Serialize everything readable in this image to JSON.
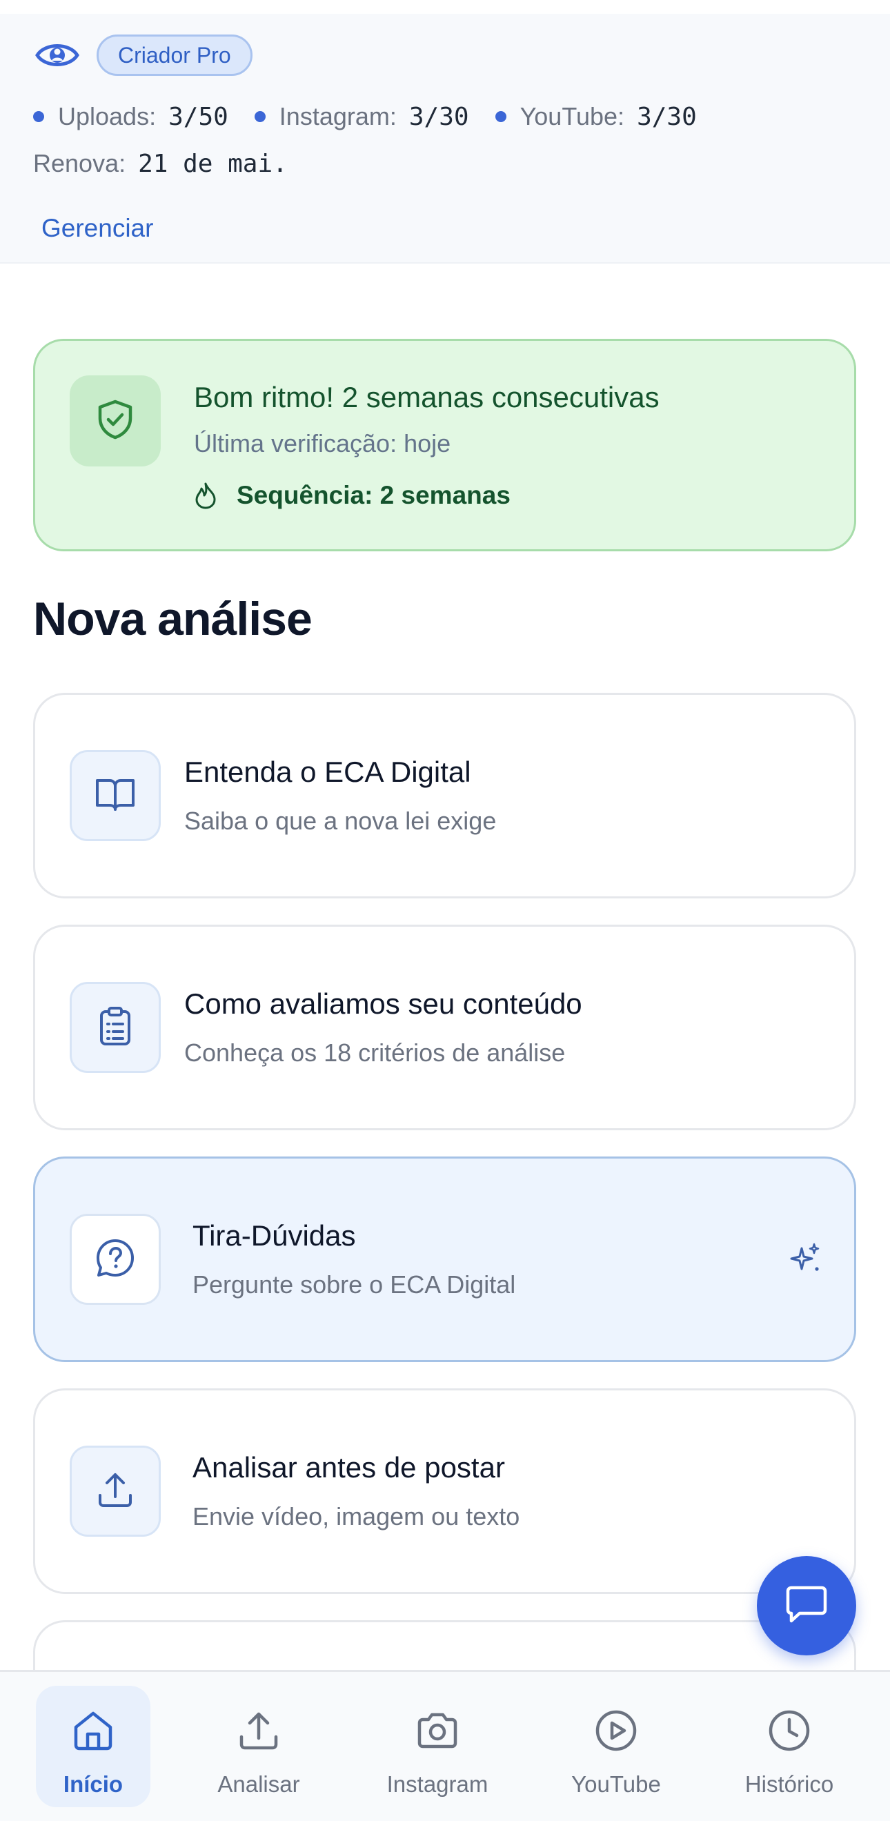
{
  "plan": {
    "badge": "Criador Pro",
    "usage": [
      {
        "label": "Uploads:",
        "value": "3/50"
      },
      {
        "label": "Instagram:",
        "value": "3/30"
      },
      {
        "label": "YouTube:",
        "value": "3/30"
      }
    ],
    "renew_label": "Renova:",
    "renew_value": "21 de mai.",
    "manage_label": "Gerenciar"
  },
  "streak": {
    "title": "Bom ritmo! 2 semanas consecutivas",
    "subtitle": "Última verificação: hoje",
    "count": "Sequência: 2 semanas"
  },
  "section_title": "Nova análise",
  "cards": [
    {
      "title": "Entenda o ECA Digital",
      "subtitle": "Saiba o que a nova lei exige",
      "icon": "book-icon"
    },
    {
      "title": "Como avaliamos seu conteúdo",
      "subtitle": "Conheça os 18 critérios de análise",
      "icon": "clipboard-list-icon"
    },
    {
      "title": "Tira-Dúvidas",
      "subtitle": "Pergunte sobre o ECA Digital",
      "icon": "help-bubble-icon"
    },
    {
      "title": "Analisar antes de postar",
      "subtitle": "Envie vídeo, imagem ou texto",
      "icon": "upload-icon"
    }
  ],
  "nav": [
    {
      "label": "Início",
      "icon": "home-icon"
    },
    {
      "label": "Analisar",
      "icon": "upload-icon"
    },
    {
      "label": "Instagram",
      "icon": "camera-icon"
    },
    {
      "label": "YouTube",
      "icon": "play-circle-icon"
    },
    {
      "label": "Histórico",
      "icon": "clock-icon"
    }
  ],
  "colors": {
    "accent": "#3560e0",
    "link": "#2f63c8",
    "success_bg": "#e2f8e3",
    "success_text": "#14532d",
    "highlight_bg": "#edf4fe"
  }
}
